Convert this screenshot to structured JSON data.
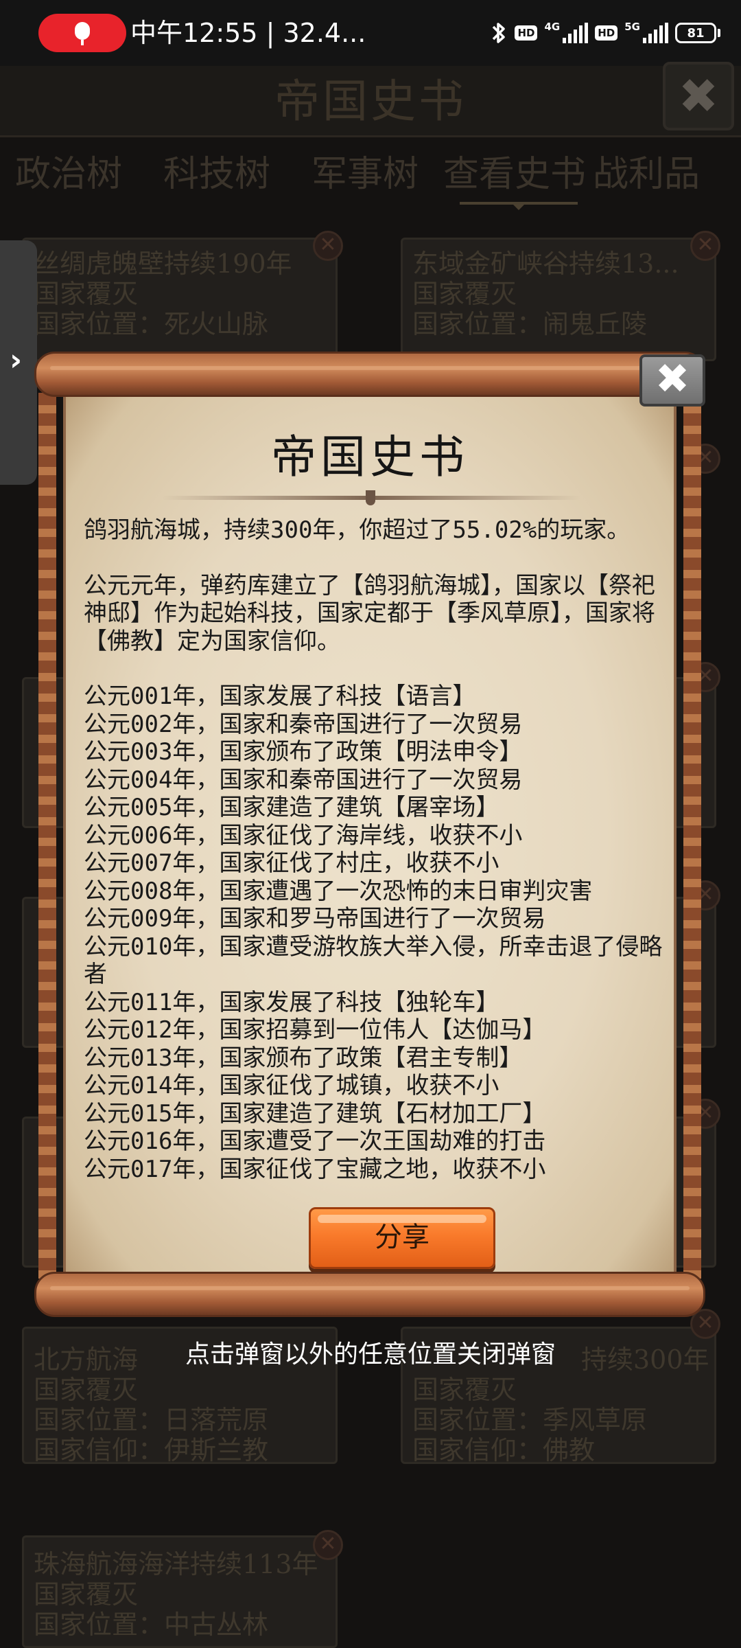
{
  "status_bar": {
    "time_text": "中午12:55 | 32.4...",
    "network_1": "4G",
    "network_2": "5G",
    "hd_label": "HD",
    "battery_level": "81"
  },
  "game": {
    "title": "帝国史书",
    "close_glyph": "✖",
    "tabs": [
      "政治树",
      "科技树",
      "军事树",
      "查看史书",
      "战利品"
    ],
    "active_tab_index": 3,
    "cards": [
      {
        "lines": [
          "丝绸虎魄壁持续190年",
          "国家覆灭",
          "国家位置：死火山脉"
        ]
      },
      {
        "lines": [
          "东域金矿峡谷持续13...",
          "国家覆灭",
          "国家位置：闹鬼丘陵"
        ]
      },
      {
        "lines": [
          "北方航海",
          "国家覆灭",
          "国家位置：日落荒原",
          "国家信仰：伊斯兰教"
        ]
      },
      {
        "lines": [
          "持续300年",
          "国家覆灭",
          "国家位置：季风草原",
          "国家信仰：佛教"
        ]
      },
      {
        "lines": [
          "珠海航海海洋持续113年",
          "国家覆灭",
          "国家位置：中古丛林"
        ]
      }
    ],
    "card_remove_glyph": "✕",
    "side_handle_glyph": "›"
  },
  "modal": {
    "title": "帝国史书",
    "close_glyph": "✖",
    "summary": "鸽羽航海城，持续300年，你超过了55.02%的玩家。",
    "intro": "公元元年，弹药库建立了【鸽羽航海城】，国家以【祭祀神邸】作为起始科技，国家定都于【季风草原】，国家将【佛教】定为国家信仰。",
    "events": [
      "公元001年，国家发展了科技【语言】",
      "公元002年，国家和秦帝国进行了一次贸易",
      "公元003年，国家颁布了政策【明法申令】",
      "公元004年，国家和秦帝国进行了一次贸易",
      "公元005年，国家建造了建筑【屠宰场】",
      "公元006年，国家征伐了海岸线，收获不小",
      "公元007年，国家征伐了村庄，收获不小",
      "公元008年，国家遭遇了一次恐怖的末日审判灾害",
      "公元009年，国家和罗马帝国进行了一次贸易",
      "公元010年，国家遭受游牧族大举入侵，所幸击退了侵略者",
      "公元011年，国家发展了科技【独轮车】",
      "公元012年，国家招募到一位伟人【达伽马】",
      "公元013年，国家颁布了政策【君主专制】",
      "公元014年，国家征伐了城镇，收获不小",
      "公元015年，国家建造了建筑【石材加工厂】",
      "公元016年，国家遭受了一次王国劫难的打击",
      "公元017年，国家征伐了宝藏之地，收获不小"
    ],
    "share_label": "分享",
    "dismiss_hint": "点击弹窗以外的任意位置关闭弹窗"
  }
}
